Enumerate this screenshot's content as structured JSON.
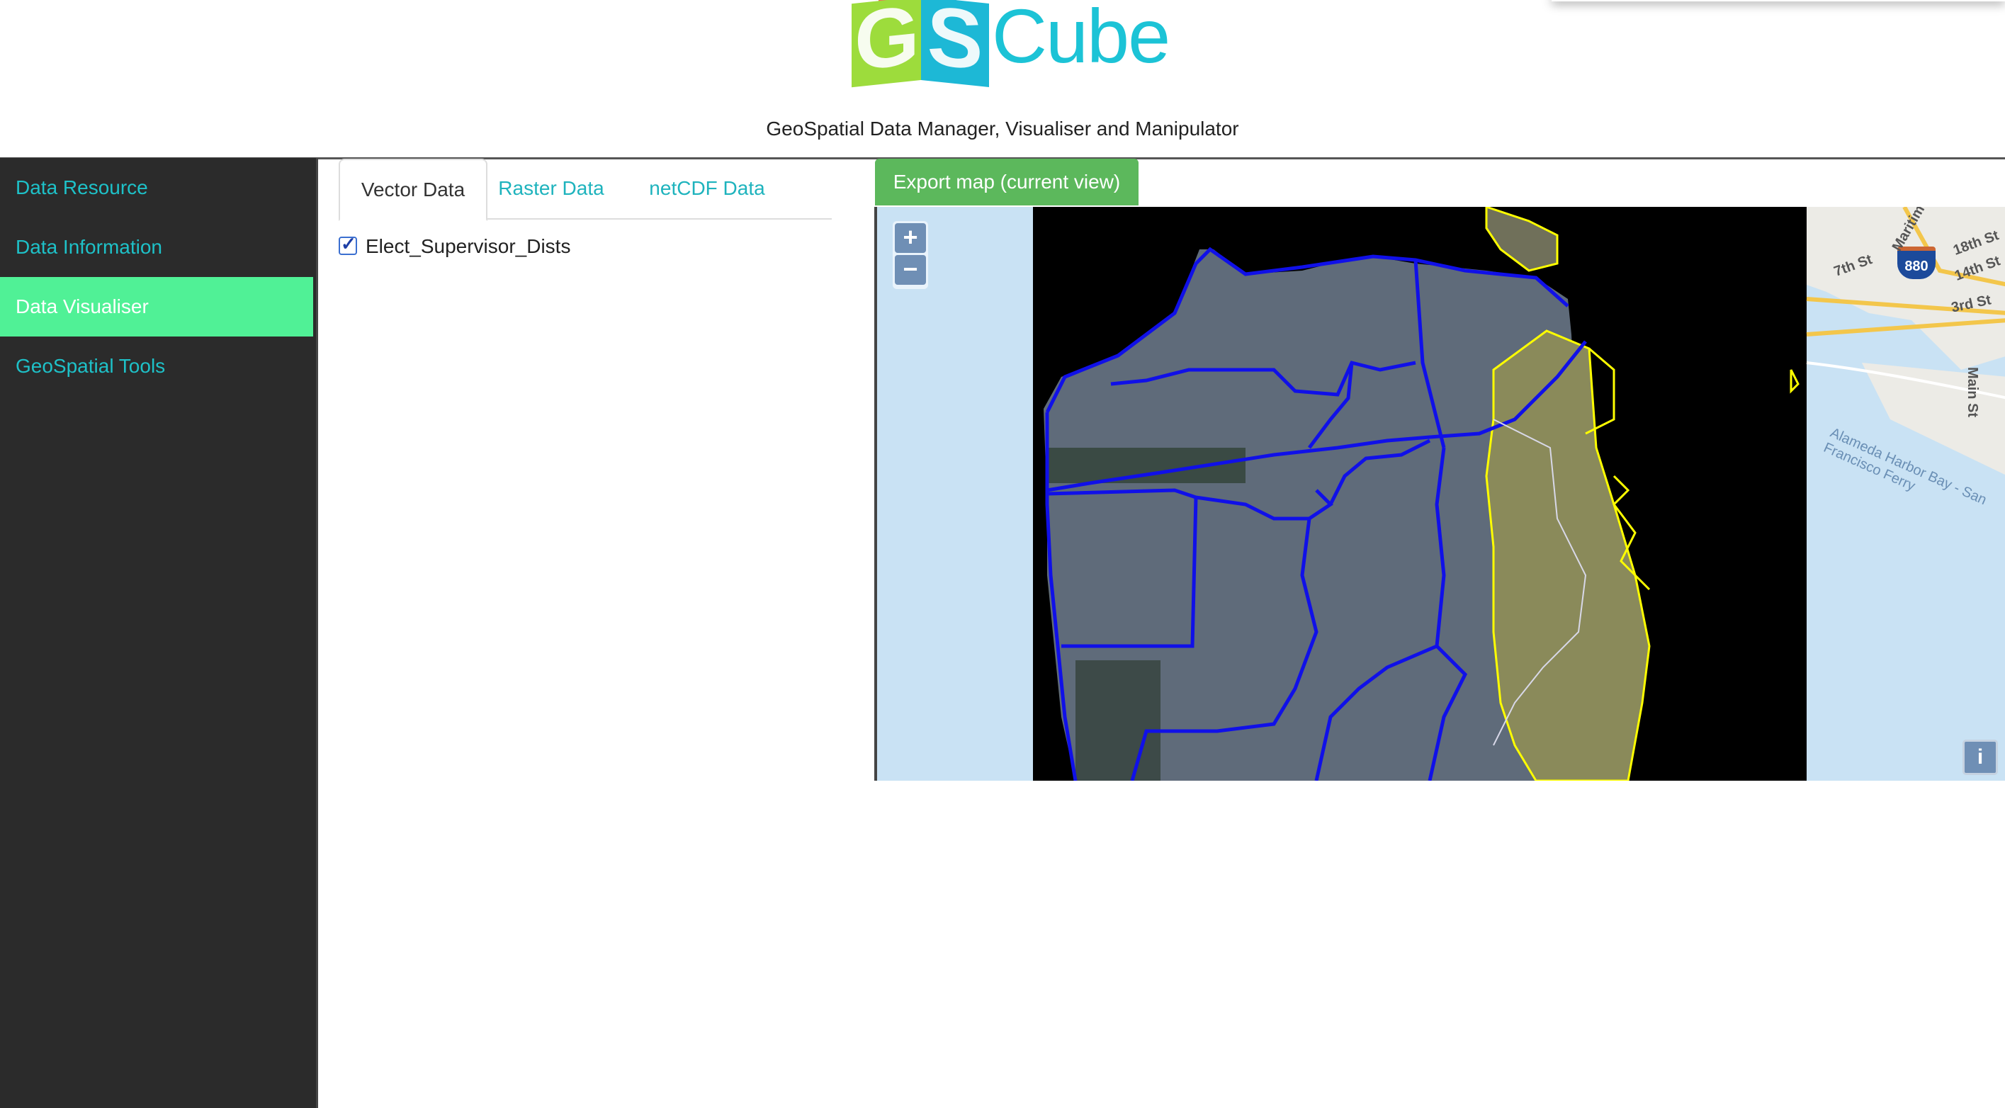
{
  "header": {
    "logo_text": "GSCube",
    "subtitle": "GeoSpatial Data Manager, Visualiser and Manipulator"
  },
  "sidebar": {
    "items": [
      {
        "label": "Data Resource",
        "active": false
      },
      {
        "label": "Data Information",
        "active": false
      },
      {
        "label": "Data Visualiser",
        "active": true
      },
      {
        "label": "GeoSpatial Tools",
        "active": false
      }
    ]
  },
  "tabs": [
    {
      "label": "Vector Data",
      "active": true
    },
    {
      "label": "Raster Data",
      "active": false
    },
    {
      "label": "netCDF Data",
      "active": false
    }
  ],
  "layers": [
    {
      "name": "Elect_Supervisor_Dists",
      "checked": true
    }
  ],
  "export_button": {
    "label": "Export map (current view)"
  },
  "map": {
    "zoom_in": "+",
    "zoom_out": "−",
    "info": "i",
    "basemap_labels": [
      "880",
      "18th St",
      "14th St",
      "7th St",
      "3rd St",
      "Main St",
      "Maritime",
      "Alameda Harbor Bay - San Francisco Ferry"
    ],
    "colors": {
      "district_outline": "#1010e8",
      "selected_outline": "#f0f000",
      "land_mask": "#000000",
      "water": "#c6e0f2"
    }
  },
  "colors": {
    "sidebar_bg": "#2b2b2b",
    "sidebar_link": "#1ec1c8",
    "sidebar_active": "#50f196",
    "export_button": "#5cb85c",
    "tab_link": "#1eb3bd"
  }
}
